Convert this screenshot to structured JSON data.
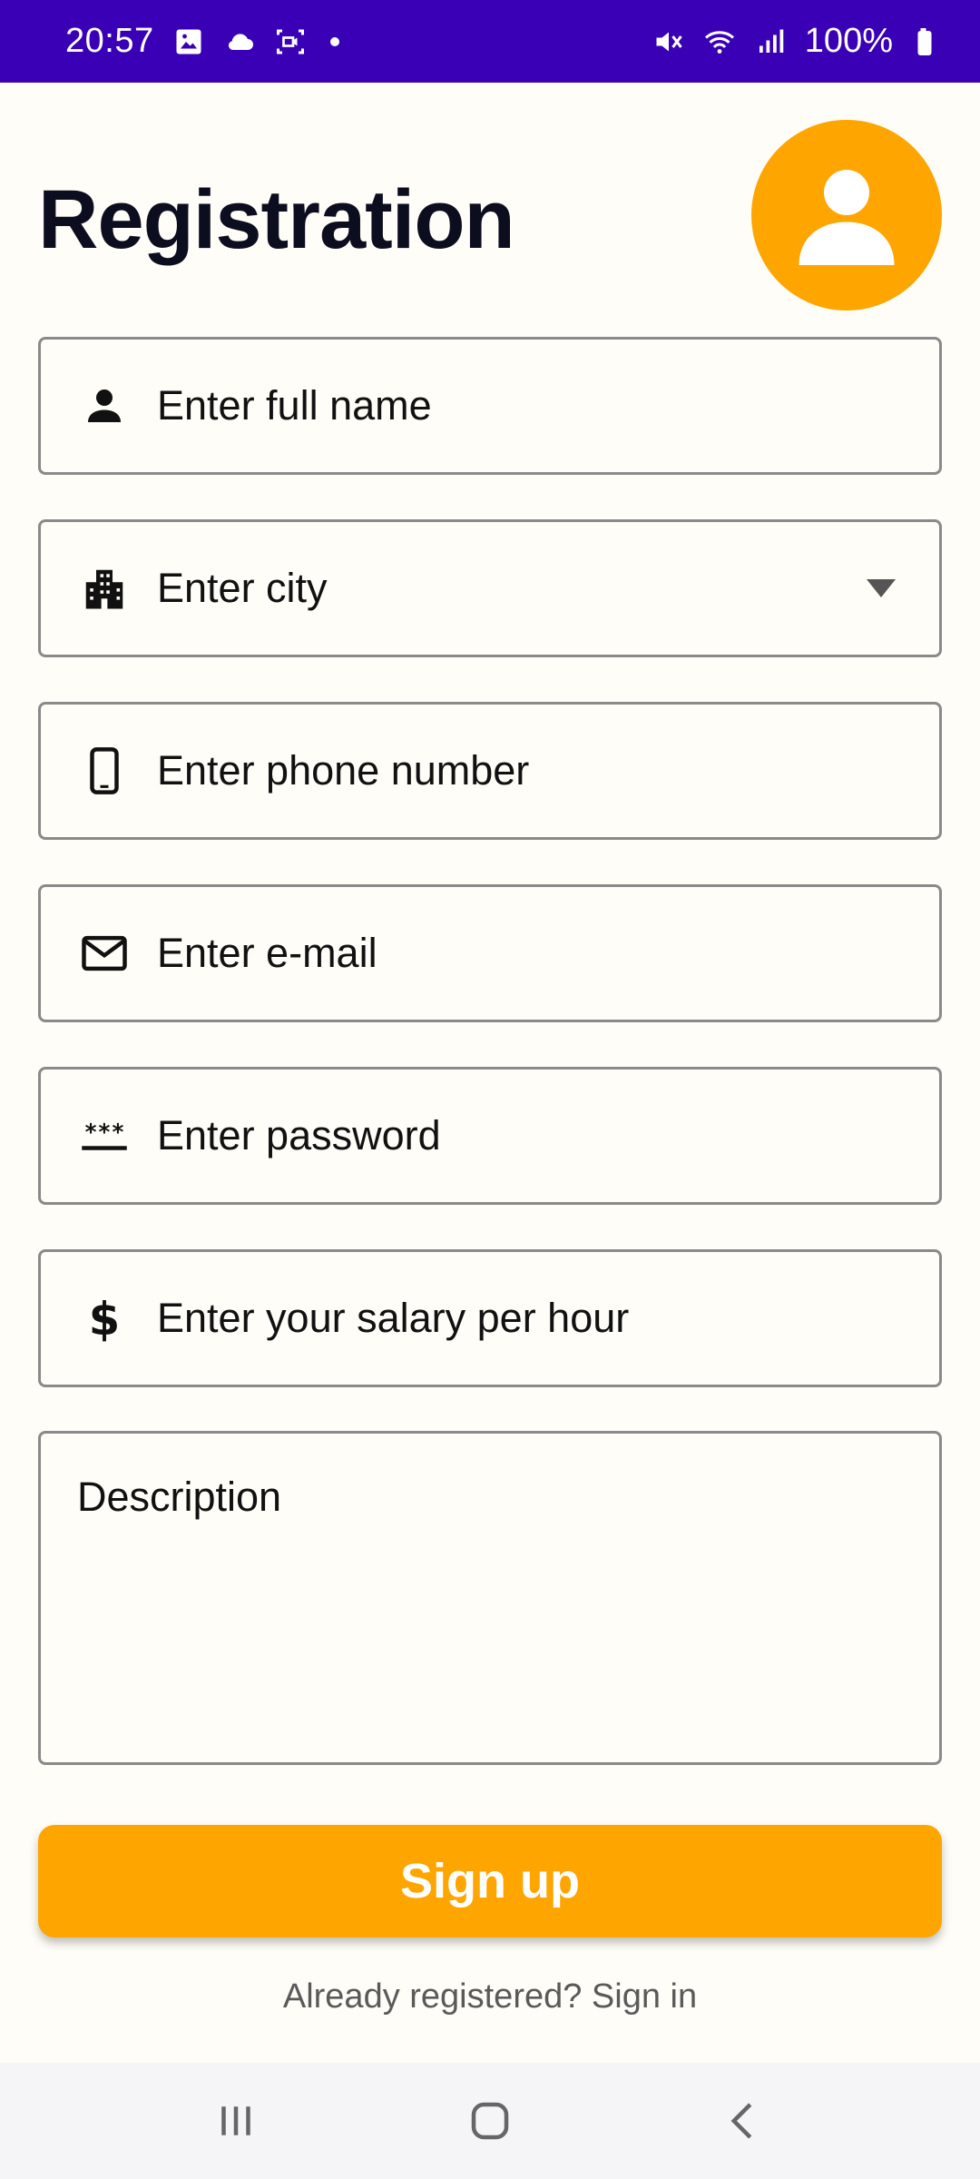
{
  "status_bar": {
    "time": "20:57",
    "battery_text": "100%",
    "icons": [
      "image-icon",
      "cloud-icon",
      "screen-record-icon",
      "dot-icon",
      "mute-icon",
      "wifi-icon",
      "signal-icon",
      "battery-icon"
    ]
  },
  "header": {
    "title": "Registration",
    "avatar_icon": "person-icon"
  },
  "form": {
    "full_name": {
      "placeholder": "Enter full name",
      "icon": "person-icon"
    },
    "city": {
      "placeholder": "Enter city",
      "icon": "building-icon"
    },
    "phone": {
      "placeholder": "Enter phone number",
      "icon": "phone-icon"
    },
    "email": {
      "placeholder": "Enter e-mail",
      "icon": "mail-icon"
    },
    "password": {
      "placeholder": "Enter password",
      "icon": "password-icon"
    },
    "salary": {
      "placeholder": "Enter your salary per hour",
      "icon": "dollar-icon"
    },
    "description": {
      "placeholder": "Description"
    }
  },
  "actions": {
    "signup_label": "Sign up",
    "signin_text": "Already registered? Sign in"
  },
  "colors": {
    "status_bar": "#3a00b5",
    "accent": "#ffa500",
    "background": "#fefdf8",
    "title": "#0d0d20",
    "border": "#8a8a8a"
  }
}
